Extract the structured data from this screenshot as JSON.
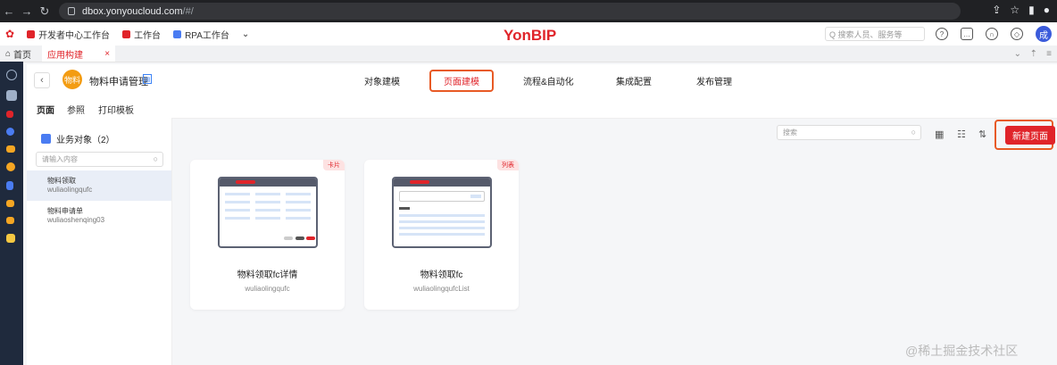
{
  "browser": {
    "url_host": "dbox.yonyoucloud.com",
    "url_path": "/#/"
  },
  "bookmarks": [
    {
      "label": "开发者中心工作台",
      "color": "#e0242a"
    },
    {
      "label": "工作台",
      "color": "#e0242a"
    },
    {
      "label": "RPA工作台",
      "color": "#4a7cf2"
    }
  ],
  "brand": "YonBIP",
  "top_search": {
    "placeholder": "Q 搜索人员、服务等"
  },
  "avatar_text": "成",
  "tabs": {
    "home": "首页",
    "active": "应用构建",
    "close": "×"
  },
  "app": {
    "title": "物料申请管理",
    "logo_text": "物料",
    "nav": [
      "对象建模",
      "页面建模",
      "流程&自动化",
      "集成配置",
      "发布管理"
    ],
    "active_nav": "页面建模"
  },
  "subtabs": [
    "页面",
    "参照",
    "打印模板"
  ],
  "sidebar": {
    "heading": "业务对象（2）",
    "search_placeholder": "请输入内容",
    "items": [
      {
        "name": "物料领取",
        "code": "wuliaolingqufc"
      },
      {
        "name": "物料申请单",
        "code": "wuliaoshenqing03"
      }
    ]
  },
  "main": {
    "search_placeholder": "搜索",
    "new_page_label": "新建页面"
  },
  "cards": [
    {
      "badge": "卡片",
      "title": "物料领取fc详情",
      "code": "wuliaolingqufc"
    },
    {
      "badge": "列表",
      "title": "物料领取fc",
      "code": "wuliaolingqufcList"
    }
  ],
  "watermark": "@稀土掘金技术社区",
  "colors": {
    "accent": "#e0242a",
    "highlight_border": "#e85a25",
    "rail": "#1f2a3d"
  }
}
